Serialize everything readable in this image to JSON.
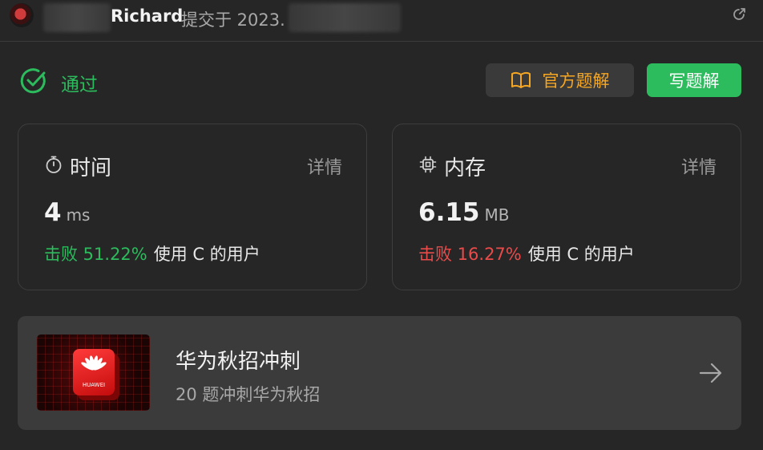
{
  "header": {
    "username": "Richard",
    "submitted_text": "提交于 2023."
  },
  "status": {
    "label": "通过",
    "color": "#2cbb5d"
  },
  "actions": {
    "official_solution_label": "官方题解",
    "write_solution_label": "写题解"
  },
  "runtime": {
    "title": "时间",
    "detail_label": "详情",
    "value": "4",
    "unit": "ms",
    "beat_text": "击败 51.22%",
    "beat_suffix": "使用 C 的用户",
    "beat_color": "#2cbb5d"
  },
  "memory": {
    "title": "内存",
    "detail_label": "详情",
    "value": "6.15",
    "unit": "MB",
    "beat_text": "击败 16.27%",
    "beat_suffix": "使用 C 的用户",
    "beat_color": "#e94b4b"
  },
  "promo": {
    "title": "华为秋招冲刺",
    "subtitle": "20 题冲刺华为秋招",
    "logo_text": "HUAWEI"
  },
  "icons": {
    "status": "check-circle-icon",
    "runtime": "stopwatch-icon",
    "memory": "chip-icon",
    "solution": "book-open-icon",
    "external": "external-link-icon",
    "promo_arrow": "arrow-right-icon"
  }
}
